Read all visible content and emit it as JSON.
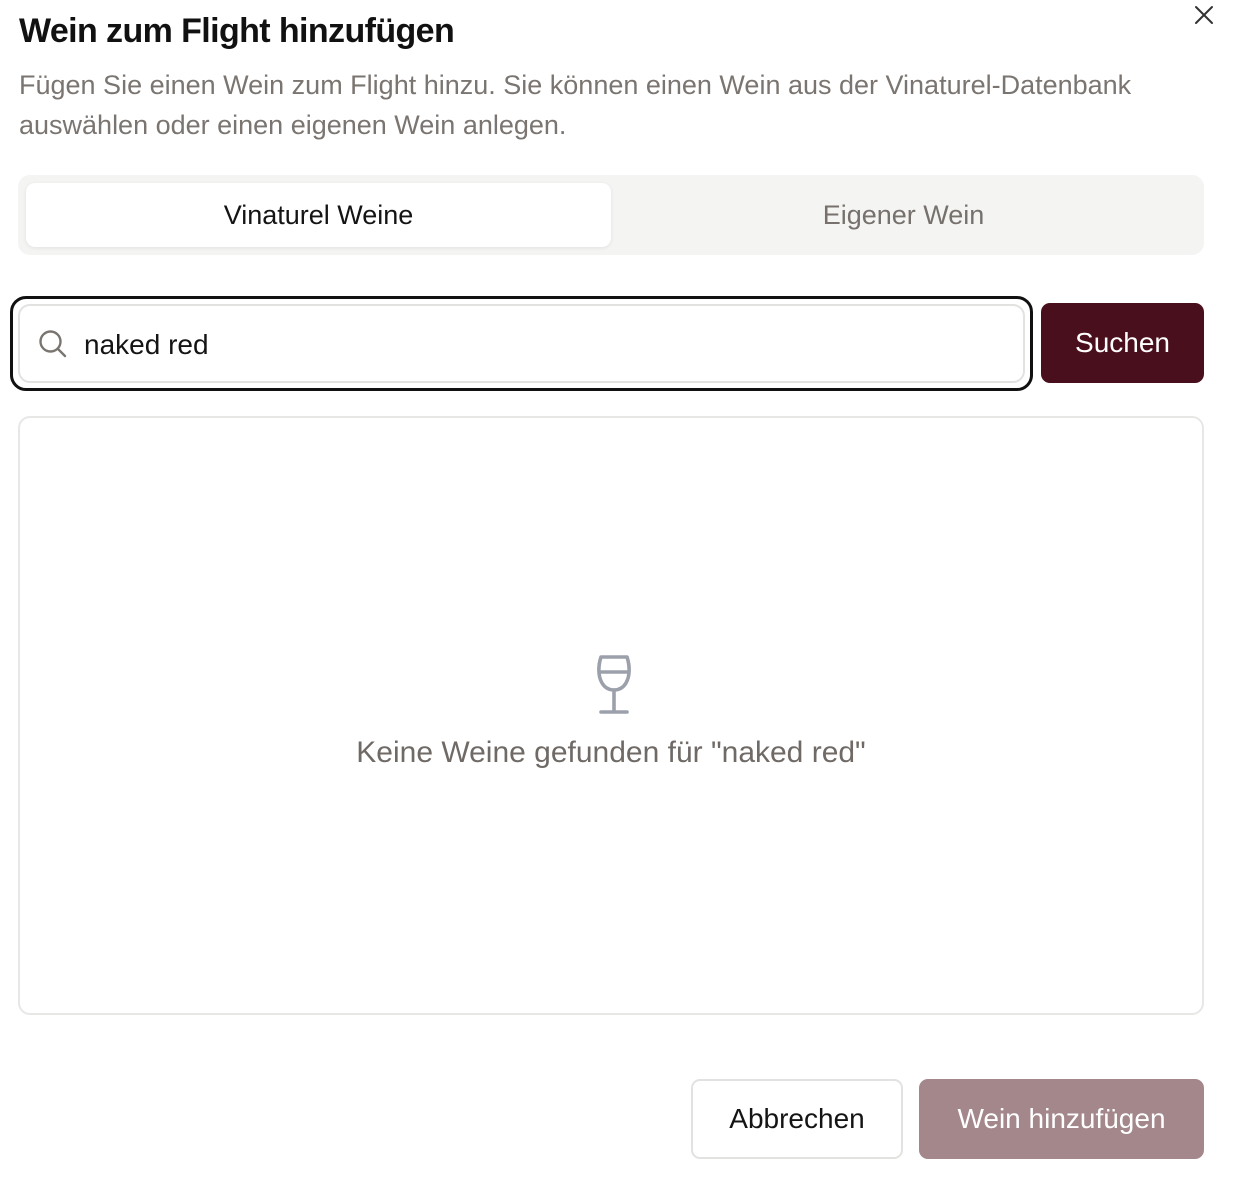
{
  "dialog": {
    "title": "Wein zum Flight hinzufügen",
    "description": "Fügen Sie einen Wein zum Flight hinzu. Sie können einen Wein aus der Vinaturel-Datenbank auswählen oder einen eigenen Wein anlegen.",
    "close_icon": "close-icon"
  },
  "tabs": [
    {
      "label": "Vinaturel Weine",
      "active": true
    },
    {
      "label": "Eigener Wein",
      "active": false
    }
  ],
  "search": {
    "value": "naked red",
    "icon": "search-icon",
    "button_label": "Suchen"
  },
  "results": {
    "icon": "wine-glass-icon",
    "empty_message": "Keine Weine gefunden für \"naked red\""
  },
  "footer": {
    "cancel_label": "Abbrechen",
    "add_label": "Wein hinzufügen",
    "add_disabled": true
  },
  "colors": {
    "primary": "#4a0f1d",
    "primary_disabled": "#a3878b",
    "muted_text": "#7a7571",
    "tab_background": "#f4f4f3",
    "border": "#e2e2e0"
  }
}
